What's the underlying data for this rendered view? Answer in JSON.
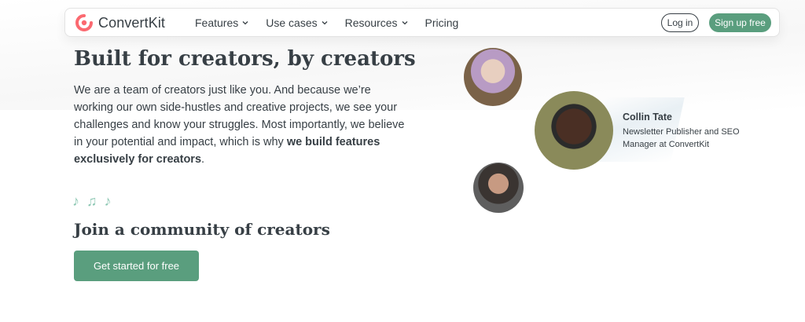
{
  "nav": {
    "brand": "ConvertKit",
    "links": [
      {
        "label": "Features",
        "dropdown": true
      },
      {
        "label": "Use cases",
        "dropdown": true
      },
      {
        "label": "Resources",
        "dropdown": true
      },
      {
        "label": "Pricing",
        "dropdown": false
      }
    ],
    "login_label": "Log in",
    "signup_label": "Sign up free"
  },
  "hero": {
    "title": "Built for creators, by creators",
    "intro_text": "We are a team of creators just like you. And because we’re working our own side-hustles and creative projects, we see your challenges and know your struggles. Most importantly, we believe in your potential and impact, which is why ",
    "intro_bold": "we build features exclusively for creators",
    "intro_end": "."
  },
  "community": {
    "notes": "♪ ♫ ♪",
    "title": "Join a community of creators",
    "cta_label": "Get started for free"
  },
  "testimonial": {
    "name": "Collin Tate",
    "role": "Newsletter Publisher and SEO Manager at ConvertKit"
  },
  "colors": {
    "accent": "#5a9e7e",
    "brand_red": "#fb6970",
    "text": "#373f45"
  },
  "icons": {
    "logo": "convertkit-logo-icon",
    "dropdown": "chevron-down-icon"
  }
}
